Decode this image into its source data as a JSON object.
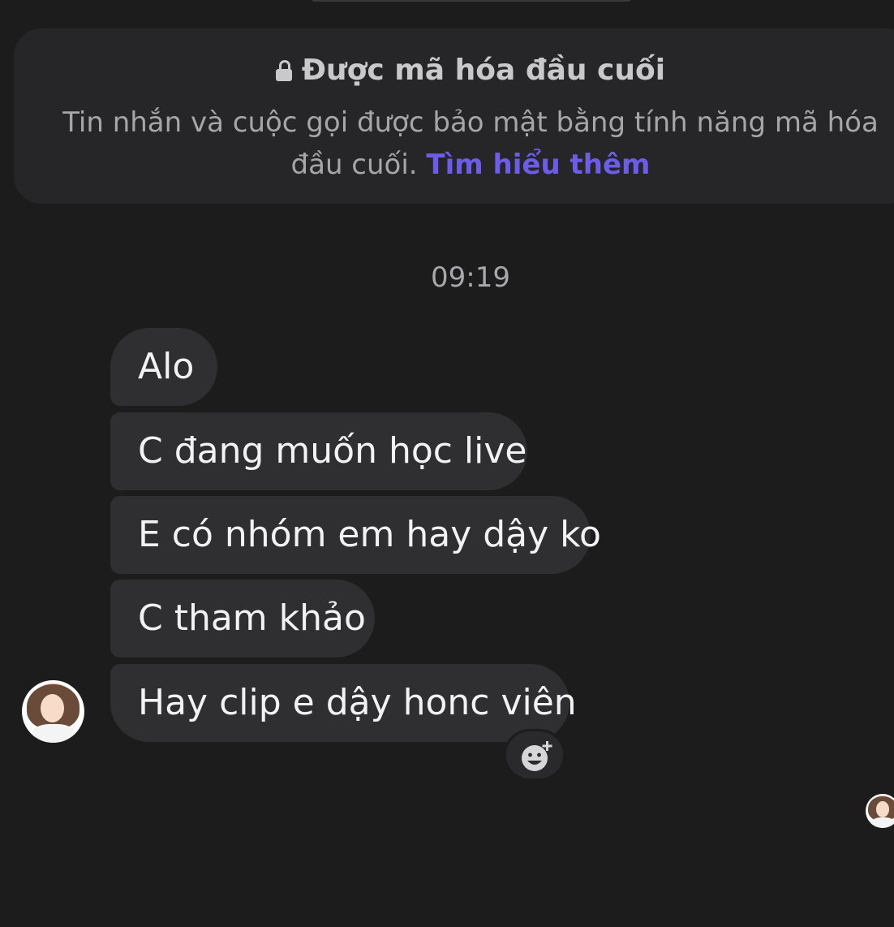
{
  "encryption_notice": {
    "title": "Được mã hóa đầu cuối",
    "description": "Tin nhắn và cuộc gọi được bảo mật bằng tính năng mã hóa đầu cuối.",
    "link_text": "Tìm hiểu thêm",
    "icon": "lock-icon"
  },
  "conversation": {
    "timestamp": "09:19",
    "messages": [
      {
        "text": "Alo"
      },
      {
        "text": "C đang muốn học live"
      },
      {
        "text": "E có nhóm em hay dậy ko"
      },
      {
        "text": "C tham khảo"
      },
      {
        "text": "Hay clip e dậy honc viên"
      }
    ]
  },
  "reaction_button": {
    "icon": "add-reaction-icon"
  },
  "colors": {
    "background": "#1c1c1d",
    "bubble": "#2f2f31",
    "link": "#6c5ce7"
  }
}
